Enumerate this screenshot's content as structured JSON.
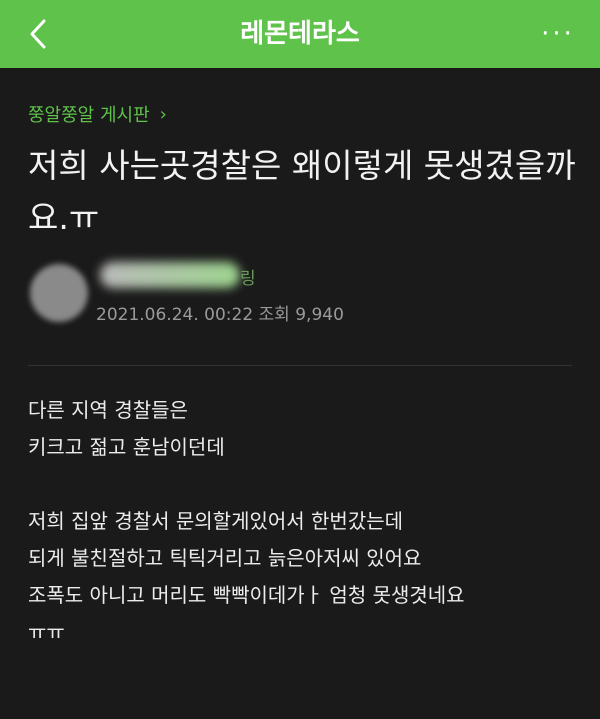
{
  "header": {
    "title": "레몬테라스",
    "back_icon": "chevron-left-icon",
    "more_label": "···",
    "bg_color": "#5fc24a"
  },
  "post": {
    "board": "쭝알쭝알 게시판",
    "board_arrow": "›",
    "title": "저희 사는곳경찰은 왜이렇게 못생겼을까요.ㅠ",
    "author_suffix": "링",
    "date": "2021.06.24. 00:22",
    "views_label": "조회 9,940",
    "body": {
      "p1_line1": "다른 지역 경찰들은",
      "p1_line2": "키크고 젊고 훈남이던데",
      "p2_line1": "저희 집앞 경찰서 문의할게있어서 한번갔는데",
      "p2_line2": "되게 불친절하고 틱틱거리고 늙은아저씨 있어요",
      "p2_line3": "조폭도 아니고 머리도 빡빡이데가ㅏ 엄청 못생겻네요",
      "p3_line1": "ㅠㅠ"
    }
  }
}
